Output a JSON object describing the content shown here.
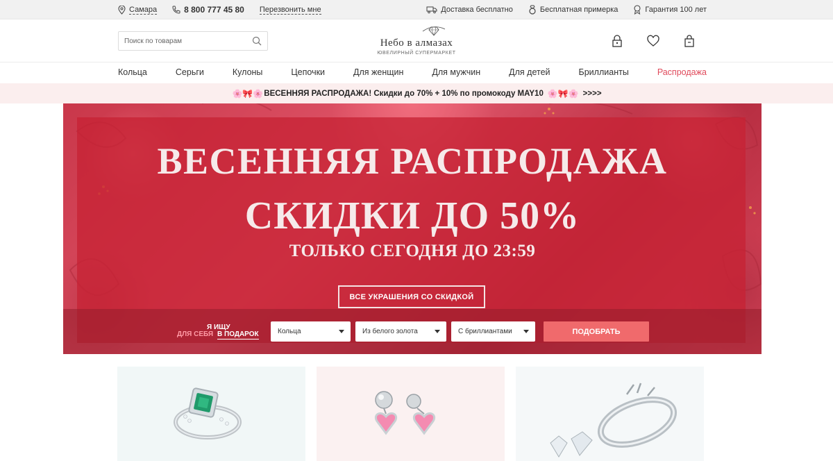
{
  "topbar": {
    "city": "Самара",
    "phone": "8 800 777 45 80",
    "callback": "Перезвонить мне",
    "delivery": "Доставка бесплатно",
    "fitting": "Бесплатная примерка",
    "warranty": "Гарантия 100 лет"
  },
  "header": {
    "search_placeholder": "Поиск по товарам",
    "logo_title": "Небо в алмазах",
    "logo_subtitle": "ЮВЕЛИРНЫЙ СУПЕРМАРКЕТ"
  },
  "nav": {
    "items": [
      {
        "label": "Кольца"
      },
      {
        "label": "Серьги"
      },
      {
        "label": "Кулоны"
      },
      {
        "label": "Цепочки"
      },
      {
        "label": "Для женщин"
      },
      {
        "label": "Для мужчин"
      },
      {
        "label": "Для детей"
      },
      {
        "label": "Бриллианты"
      },
      {
        "label": "Распродажа"
      }
    ]
  },
  "promo": {
    "emoji_left": "🌸🎀🌸",
    "text": "ВЕСЕННЯЯ РАСПРОДАЖА! Скидки до 70% + 10% по промокоду MAY10",
    "emoji_right": "🌸🎀🌸",
    "arrows": ">>>>"
  },
  "hero": {
    "title": "ВЕСЕННЯЯ РАСПРОДАЖА",
    "subtitle": "СКИДКИ ДО 50%",
    "note": "ТОЛЬКО СЕГОДНЯ ДО 23:59",
    "button": "ВСЕ УКРАШЕНИЯ СО СКИДКОЙ"
  },
  "finder": {
    "label": "Я ИЩУ",
    "for_self": "ДЛЯ СЕБЯ",
    "as_gift": "В ПОДАРОК",
    "select_type": "Кольца",
    "select_metal": "Из белого золота",
    "select_stone": "С бриллиантами",
    "submit": "ПОДОБРАТЬ"
  },
  "colors": {
    "accent": "#e04a5b",
    "button": "#f06a6c",
    "overlay": "#c62234"
  }
}
